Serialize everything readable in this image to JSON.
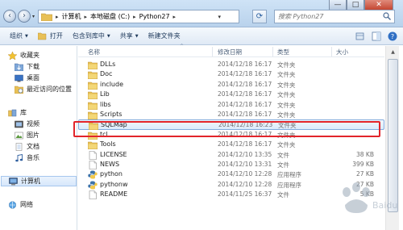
{
  "window": {
    "close_glyph": "✕",
    "max_glyph": "□",
    "min_glyph": "—"
  },
  "address": {
    "crumbs": [
      "计算机",
      "本地磁盘 (C:)",
      "Python27"
    ],
    "search_placeholder": "搜索 Python27"
  },
  "toolbar": {
    "organize": "组织",
    "open": "打开",
    "include_in_library": "包含到库中",
    "share": "共享",
    "new_folder": "新建文件夹"
  },
  "sidebar": {
    "favorites": "收藏夹",
    "downloads": "下载",
    "desktop": "桌面",
    "recent": "最近访问的位置",
    "libraries": "库",
    "videos": "视频",
    "pictures": "图片",
    "documents": "文档",
    "music": "音乐",
    "computer": "计算机",
    "network": "网络"
  },
  "columns": {
    "name": "名称",
    "modified": "修改日期",
    "type": "类型",
    "size": "大小"
  },
  "files": [
    {
      "name": "DLLs",
      "date": "2014/12/18 16:17",
      "type": "文件夹",
      "size": "",
      "icon": "folder"
    },
    {
      "name": "Doc",
      "date": "2014/12/18 16:17",
      "type": "文件夹",
      "size": "",
      "icon": "folder"
    },
    {
      "name": "include",
      "date": "2014/12/18 16:17",
      "type": "文件夹",
      "size": "",
      "icon": "folder"
    },
    {
      "name": "Lib",
      "date": "2014/12/18 16:17",
      "type": "文件夹",
      "size": "",
      "icon": "folder"
    },
    {
      "name": "libs",
      "date": "2014/12/18 16:17",
      "type": "文件夹",
      "size": "",
      "icon": "folder"
    },
    {
      "name": "Scripts",
      "date": "2014/12/18 16:17",
      "type": "文件夹",
      "size": "",
      "icon": "folder"
    },
    {
      "name": "SQLMap",
      "date": "2014/12/18 16:23",
      "type": "文件夹",
      "size": "",
      "icon": "folder"
    },
    {
      "name": "tcl",
      "date": "2014/12/18 16:17",
      "type": "文件夹",
      "size": "",
      "icon": "folder"
    },
    {
      "name": "Tools",
      "date": "2014/12/18 16:17",
      "type": "文件夹",
      "size": "",
      "icon": "folder"
    },
    {
      "name": "LICENSE",
      "date": "2014/12/10 13:35",
      "type": "文件",
      "size": "38 KB",
      "icon": "file"
    },
    {
      "name": "NEWS",
      "date": "2014/12/10 13:31",
      "type": "文件",
      "size": "399 KB",
      "icon": "file"
    },
    {
      "name": "python",
      "date": "2014/12/10 12:28",
      "type": "应用程序",
      "size": "27 KB",
      "icon": "python"
    },
    {
      "name": "pythonw",
      "date": "2014/12/10 12:28",
      "type": "应用程序",
      "size": "27 KB",
      "icon": "python"
    },
    {
      "name": "README",
      "date": "2014/11/25 16:37",
      "type": "文件",
      "size": "5 KB",
      "icon": "file"
    }
  ],
  "selected_file_index": 6,
  "watermark_text": "Baidu 经验",
  "colors": {
    "highlight_border": "#e2252b",
    "folder_yellow": "#e8c056",
    "selection_border": "#84acdd"
  }
}
